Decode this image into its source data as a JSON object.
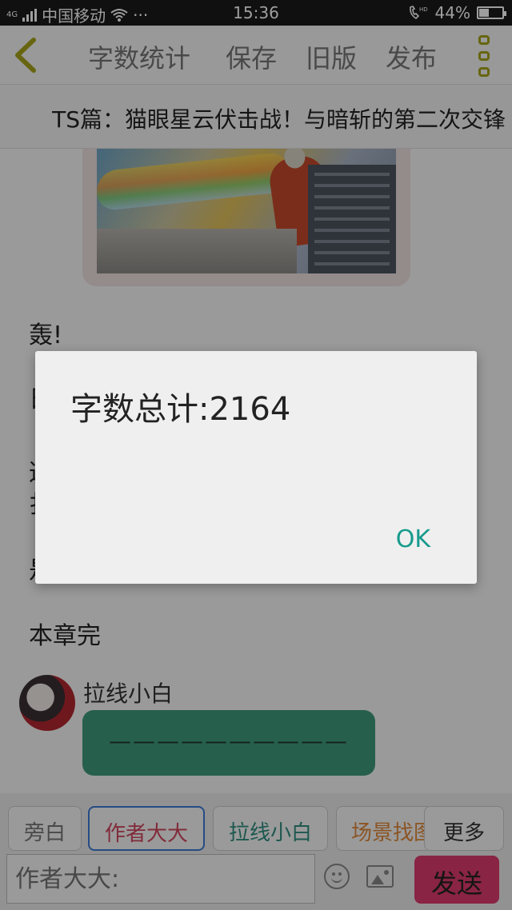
{
  "status_bar": {
    "network_type": "4G",
    "carrier": "中国移动",
    "more": "···",
    "time": "15:36",
    "hd_label": "HD",
    "battery_text": "44%",
    "battery_level": 0.44
  },
  "toolbar": {
    "back_icon": "chevron-left-icon",
    "word_count_label": "字数统计",
    "save_label": "保存",
    "old_version_label": "旧版",
    "publish_label": "发布",
    "menu_icon": "vertical-dots-icon",
    "accent_color": "#a7a41a"
  },
  "chapter": {
    "title": "TS篇：猫眼星云伏击战！与暗斩的第二次交锋"
  },
  "content": {
    "paragraphs": [
      "轰!",
      "日",
      "这",
      "扌",
      "是",
      "本章完"
    ],
    "message": {
      "name": "拉线小白",
      "text": "——————————",
      "bubble_color": "#3f9a7d"
    }
  },
  "role_bar": {
    "buttons": [
      "旁白",
      "作者大大",
      "拉线小白",
      "场景找图"
    ],
    "more_label": "更多"
  },
  "input_bar": {
    "placeholder": "作者大大:",
    "emoji_icon": "smiley-icon",
    "image_icon": "image-icon",
    "send_label": "发送",
    "send_color": "#de3b6e"
  },
  "dialog": {
    "message": "字数总计:2164",
    "ok_label": "OK",
    "ok_color": "#169b8c"
  }
}
